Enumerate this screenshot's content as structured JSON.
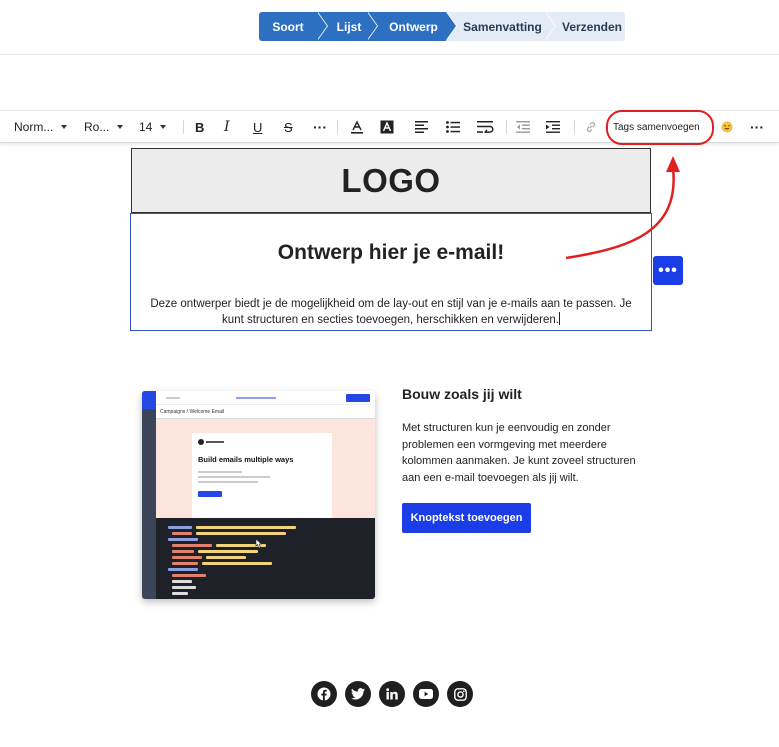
{
  "stepper": {
    "steps": [
      {
        "label": "Soort",
        "state": "done"
      },
      {
        "label": "Lijst",
        "state": "done"
      },
      {
        "label": "Ontwerp",
        "state": "current"
      },
      {
        "label": "Samenvatting",
        "state": "todo"
      },
      {
        "label": "Verzenden",
        "state": "todo"
      }
    ]
  },
  "toolbar": {
    "paragraph_style": "Norm...",
    "font_family": "Ro...",
    "font_size": "14",
    "bold_icon": "bold-icon",
    "italic_icon": "italic-icon",
    "underline_icon": "underline-icon",
    "strike_icon": "strikethrough-icon",
    "more_icon": "more-horizontal-icon",
    "text_color_icon": "text-color-icon",
    "bg_color_icon": "highlight-color-icon",
    "align_icon": "align-left-icon",
    "list_icon": "bullet-list-icon",
    "wrap_icon": "text-wrap-icon",
    "outdent_icon": "outdent-icon",
    "indent_icon": "indent-icon",
    "link_icon": "link-icon",
    "merge_tags_label": "Tags samenvoegen",
    "emoji_icon": "emoji-icon",
    "overflow_icon": "more-horizontal-icon"
  },
  "email": {
    "logo_text": "LOGO",
    "headline": "Ontwerp hier je e-mail!",
    "body": "Deze ontwerper biedt je de mogelijkheid om de lay-out en stijl van je e-mails aan te passen. Je kunt structuren en secties toevoegen, herschikken en verwijderen.",
    "block_menu_icon": "more-horizontal-icon",
    "feature": {
      "title": "Bouw zoals jij wilt",
      "text": "Met structuren kun je eenvoudig en zonder problemen een vormgeving met meerdere kolommen aanmaken. Je kunt zoveel structuren aan een e-mail toevoegen als jij wilt.",
      "button_label": "Knoptekst toevoegen",
      "preview": {
        "breadcrumb": "Campaigns / Welcome Email",
        "card_title": "Build emails multiple ways"
      }
    },
    "social_icons": [
      "facebook-icon",
      "twitter-icon",
      "linkedin-icon",
      "youtube-icon",
      "instagram-icon"
    ]
  },
  "colors": {
    "step_done": "#2d6fc1",
    "step_todo": "#e3ebf7",
    "primary_button": "#1a3de8",
    "annotation_red": "#e02020"
  }
}
